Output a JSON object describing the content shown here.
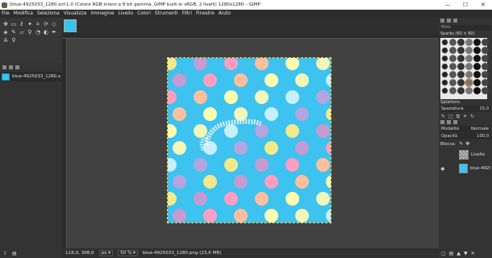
{
  "window": {
    "title": "[blue-4925033_1280.xcf-1.0 (Colore RGB intero a 8 bit gamma, GIMP built-in sRGB, 2 livelli) 1280x1280 – GIMP",
    "min_icon": "minimize-icon",
    "max_icon": "maximize-icon",
    "close_icon": "close-icon"
  },
  "menu": [
    "File",
    "Modifica",
    "Seleziona",
    "Visualizza",
    "Immagine",
    "Livello",
    "Colori",
    "Strumenti",
    "Filtri",
    "Finestre",
    "Aiuto"
  ],
  "images_panel": {
    "item_label": "blue-4925033_1280.x"
  },
  "status": {
    "coords": "118,0, 398,0",
    "unit": "px",
    "zoom": "50 %",
    "info": "blue-4925033_1280.png (23,6 MB)"
  },
  "brushes": {
    "filter": "filtro",
    "current": "Sparks (60 × 60)",
    "selected_name": "Splatters.",
    "spacing_label": "Spaziatura",
    "spacing_value": "15,0"
  },
  "layers": {
    "tab_mode": "Modalità",
    "mode_value": "Normale",
    "opacity_label": "Opacità",
    "opacity_value": "100,0",
    "lock_label": "Blocca:",
    "items": [
      {
        "name": "Livello",
        "visible": false
      },
      {
        "name": "blue-4925",
        "visible": true
      }
    ]
  },
  "colors": {
    "image_bg": "#3ec2ef",
    "dots": [
      "#f1e98a",
      "#ffbf9c",
      "#c7f0f8",
      "#c69bd1",
      "#fffeb0",
      "#b3a5e0",
      "#ff9ec0",
      "#f2f6b9"
    ]
  }
}
